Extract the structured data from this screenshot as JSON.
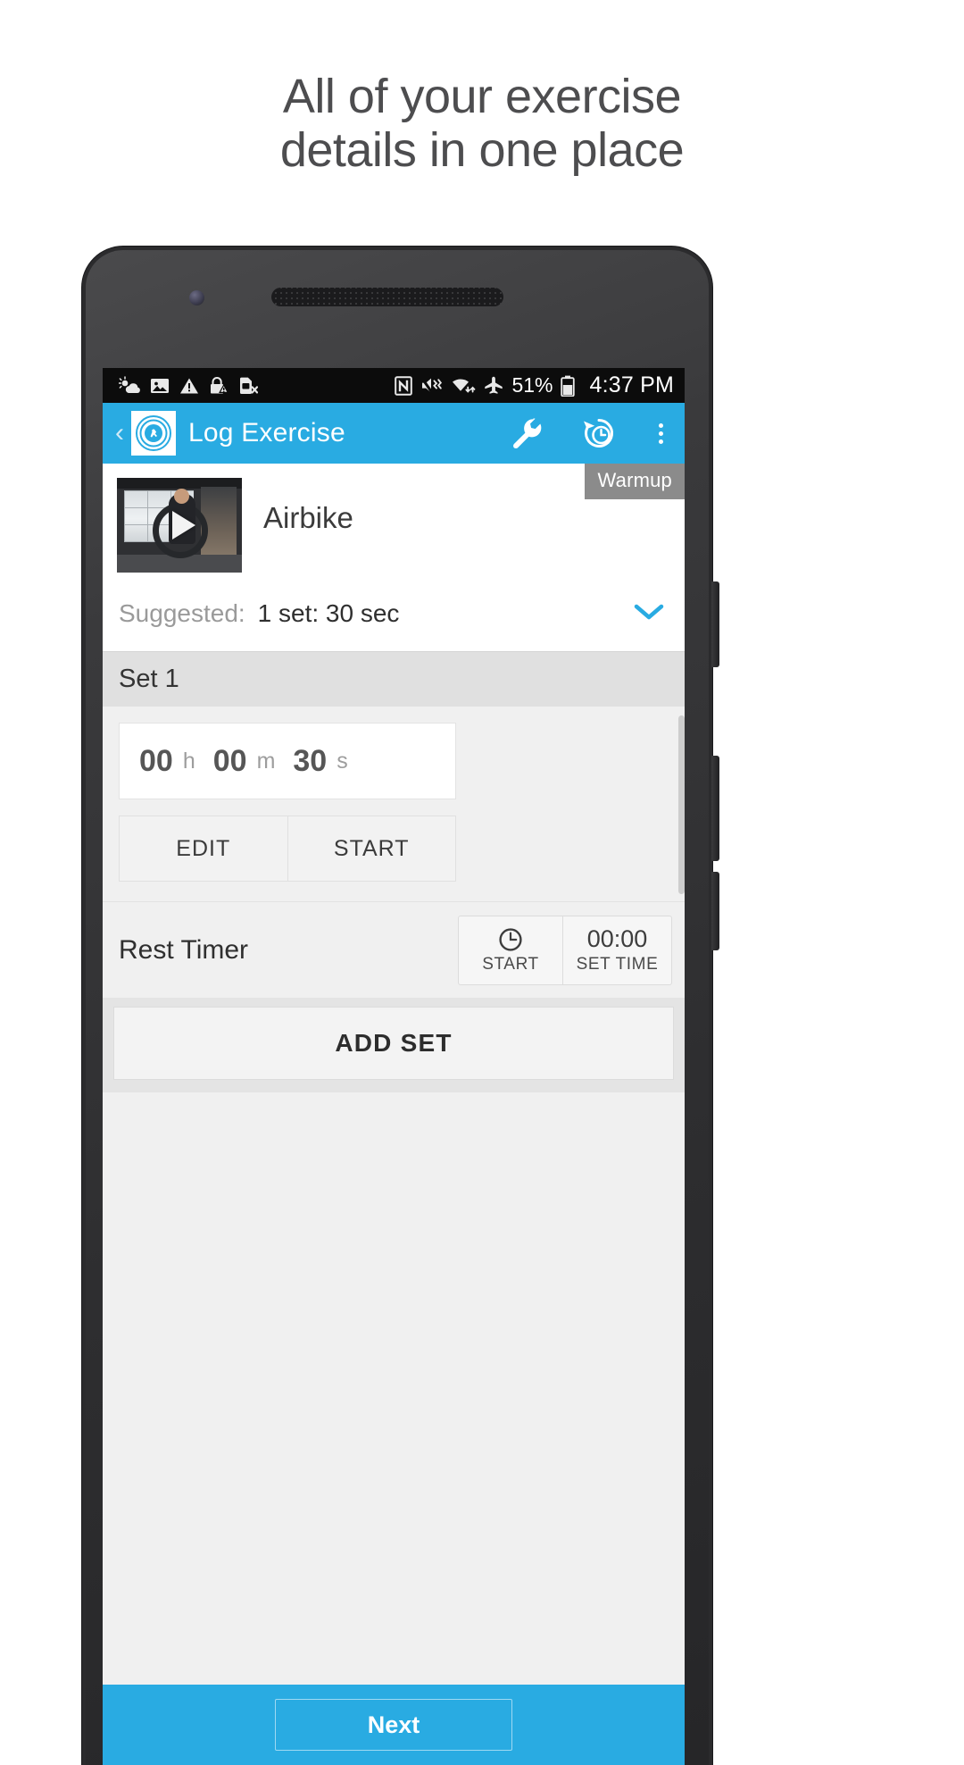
{
  "promo": {
    "headline_line1": "All of your exercise",
    "headline_line2": "details in one place"
  },
  "colors": {
    "accent": "#29abe2",
    "statusbar_bg": "#0c0c0c",
    "set_header_bg": "#e0e0e0",
    "badge_bg": "#8b8b8b"
  },
  "statusbar": {
    "icons_left": [
      "weather-icon",
      "image-icon",
      "warning-icon",
      "lock-warning-icon",
      "sim-card-removed-icon"
    ],
    "icons_right": [
      "nfc-icon",
      "vibrate-mute-icon",
      "wifi-icon",
      "airplane-mode-icon"
    ],
    "battery_percent": "51%",
    "battery_icon": "battery-icon",
    "time": "4:37 PM"
  },
  "appbar": {
    "back_icon": "back-chevron-icon",
    "logo_icon": "app-logo-icon",
    "title": "Log Exercise",
    "wrench_icon": "wrench-icon",
    "history_icon": "history-clock-icon",
    "overflow_icon": "overflow-menu-icon"
  },
  "exercise": {
    "badge": "Warmup",
    "name": "Airbike",
    "thumbnail_icon": "video-thumbnail",
    "play_icon": "play-icon",
    "suggested_label": "Suggested:",
    "suggested_value": "1 set: 30 sec",
    "expand_icon": "chevron-down-icon"
  },
  "set": {
    "header": "Set 1",
    "timer": {
      "hours": "00",
      "hours_unit": "h",
      "minutes": "00",
      "minutes_unit": "m",
      "seconds": "30",
      "seconds_unit": "s"
    },
    "edit_label": "EDIT",
    "start_label": "START"
  },
  "rest_timer": {
    "label": "Rest Timer",
    "start_icon": "clock-icon",
    "start_label": "START",
    "time_value": "00:00",
    "set_time_label": "SET TIME"
  },
  "add_set": {
    "label": "ADD SET"
  },
  "bottom": {
    "next_label": "Next"
  }
}
